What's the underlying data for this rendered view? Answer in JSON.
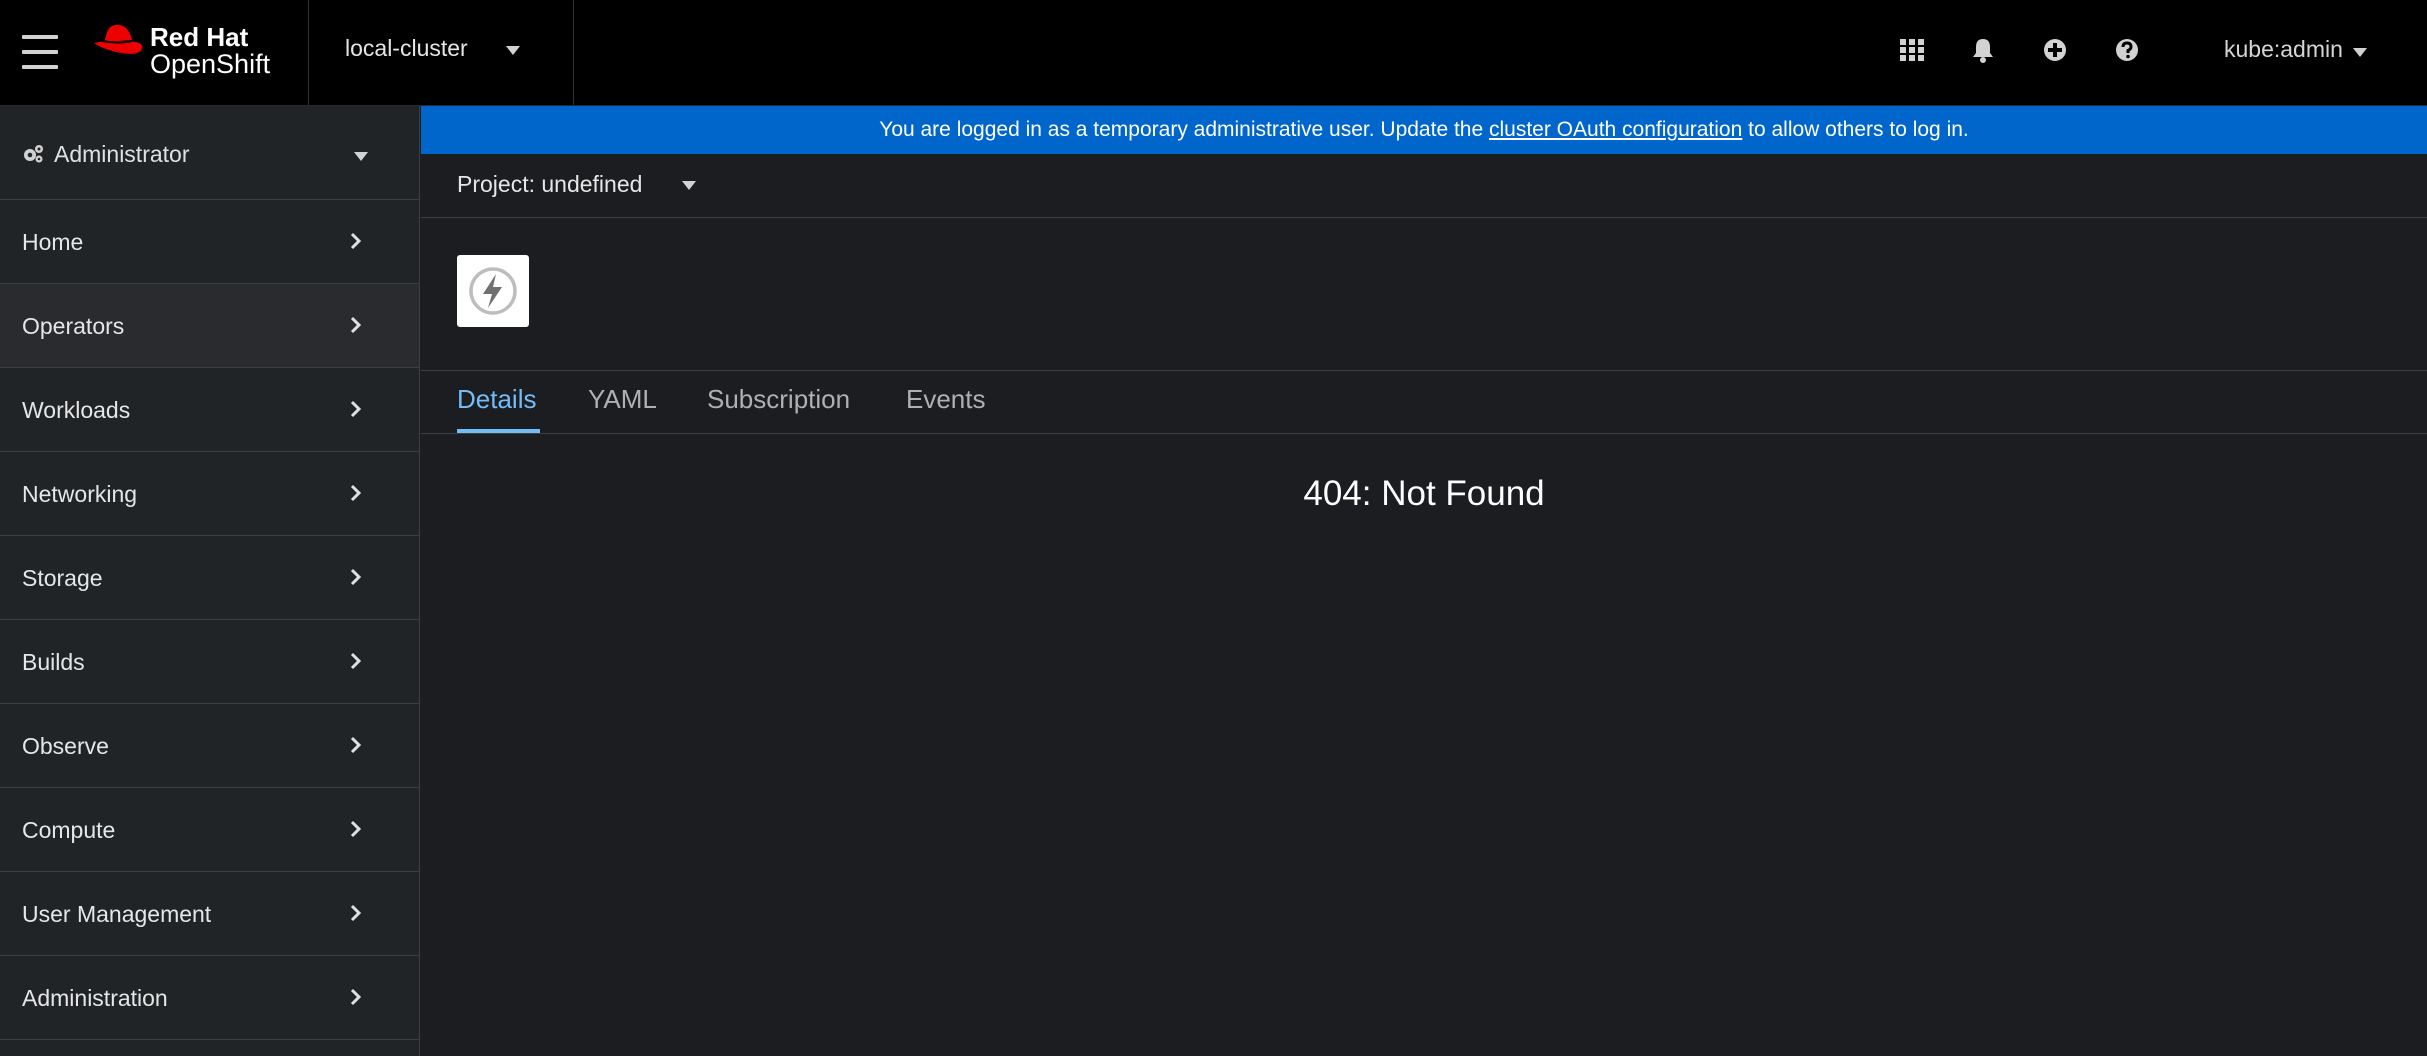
{
  "masthead": {
    "brand_line1": "Red Hat",
    "brand_line2": "OpenShift",
    "cluster": "local-cluster",
    "user": "kube:admin",
    "icons": [
      "menu-icon",
      "application-launcher-icon",
      "bell-icon",
      "plus-circle-icon",
      "help-icon"
    ]
  },
  "sidebar": {
    "perspective": "Administrator",
    "items": [
      {
        "label": "Home"
      },
      {
        "label": "Operators"
      },
      {
        "label": "Workloads"
      },
      {
        "label": "Networking"
      },
      {
        "label": "Storage"
      },
      {
        "label": "Builds"
      },
      {
        "label": "Observe"
      },
      {
        "label": "Compute"
      },
      {
        "label": "User Management"
      },
      {
        "label": "Administration"
      }
    ]
  },
  "banner": {
    "text_before": "You are logged in as a temporary administrative user. Update the ",
    "link": "cluster OAuth configuration",
    "text_after": " to allow others to log in."
  },
  "project": {
    "label": "Project: undefined"
  },
  "tabs": [
    "Details",
    "YAML",
    "Subscription",
    "Events"
  ],
  "main": {
    "message": "404: Not Found"
  },
  "colors": {
    "banner": "#0066cc",
    "active_tab": "#73bcf7",
    "background": "#1b1d21",
    "brand_red": "#ee0000"
  }
}
